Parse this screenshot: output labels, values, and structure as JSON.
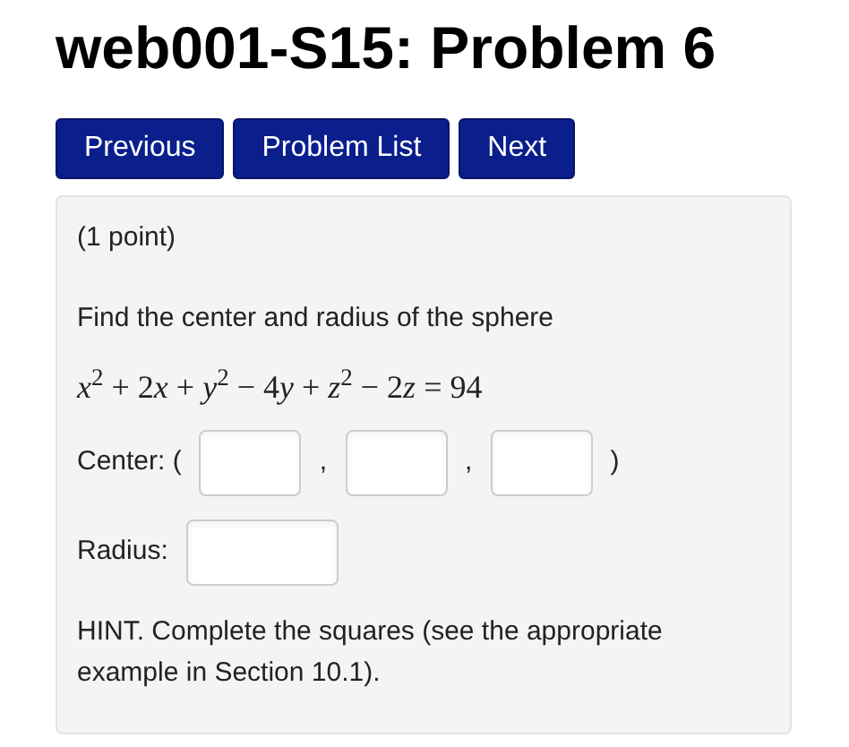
{
  "title": "web001-S15: Problem 6",
  "nav_buttons": [
    "Previous",
    "Problem List",
    "Next"
  ],
  "problem": {
    "points": "(1 point)",
    "question": "Find the center and radius of the sphere",
    "equation": [
      {
        "kind": "var",
        "text": "x"
      },
      {
        "kind": "sup",
        "text": "2"
      },
      {
        "kind": "plain",
        "text": " + 2"
      },
      {
        "kind": "var",
        "text": "x"
      },
      {
        "kind": "plain",
        "text": " + "
      },
      {
        "kind": "var",
        "text": "y"
      },
      {
        "kind": "sup",
        "text": "2"
      },
      {
        "kind": "plain",
        "text": " − 4"
      },
      {
        "kind": "var",
        "text": "y"
      },
      {
        "kind": "plain",
        "text": " + "
      },
      {
        "kind": "var",
        "text": "z"
      },
      {
        "kind": "sup",
        "text": "2"
      },
      {
        "kind": "plain",
        "text": " − 2"
      },
      {
        "kind": "var",
        "text": "z"
      },
      {
        "kind": "plain",
        "text": " = 94"
      }
    ],
    "center": {
      "label": "Center: (",
      "separators": [
        ",",
        ","
      ],
      "close": ")"
    },
    "radius": {
      "label": "Radius:"
    },
    "hint": "HINT. Complete the squares (see the appropriate example in Section 10.1)."
  }
}
